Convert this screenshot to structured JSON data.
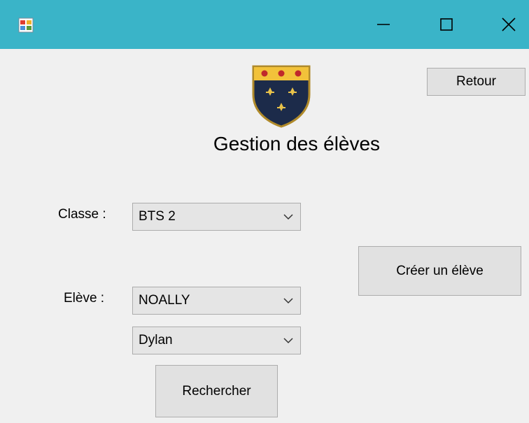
{
  "window": {
    "title_icon": "winforms-app-icon",
    "titlebar_color": "#3ab4c8",
    "controls": {
      "minimize": "minimize-icon",
      "maximize": "maximize-icon",
      "close": "close-icon"
    }
  },
  "header": {
    "logo": "school-crest-icon",
    "title": "Gestion des élèves",
    "back_label": "Retour"
  },
  "form": {
    "classe_label": "Classe :",
    "classe_value": "BTS 2",
    "eleve_label": "Elève :",
    "nom_value": "NOALLY",
    "prenom_value": "Dylan",
    "create_label": "Créer un élève",
    "search_label": "Rechercher"
  }
}
